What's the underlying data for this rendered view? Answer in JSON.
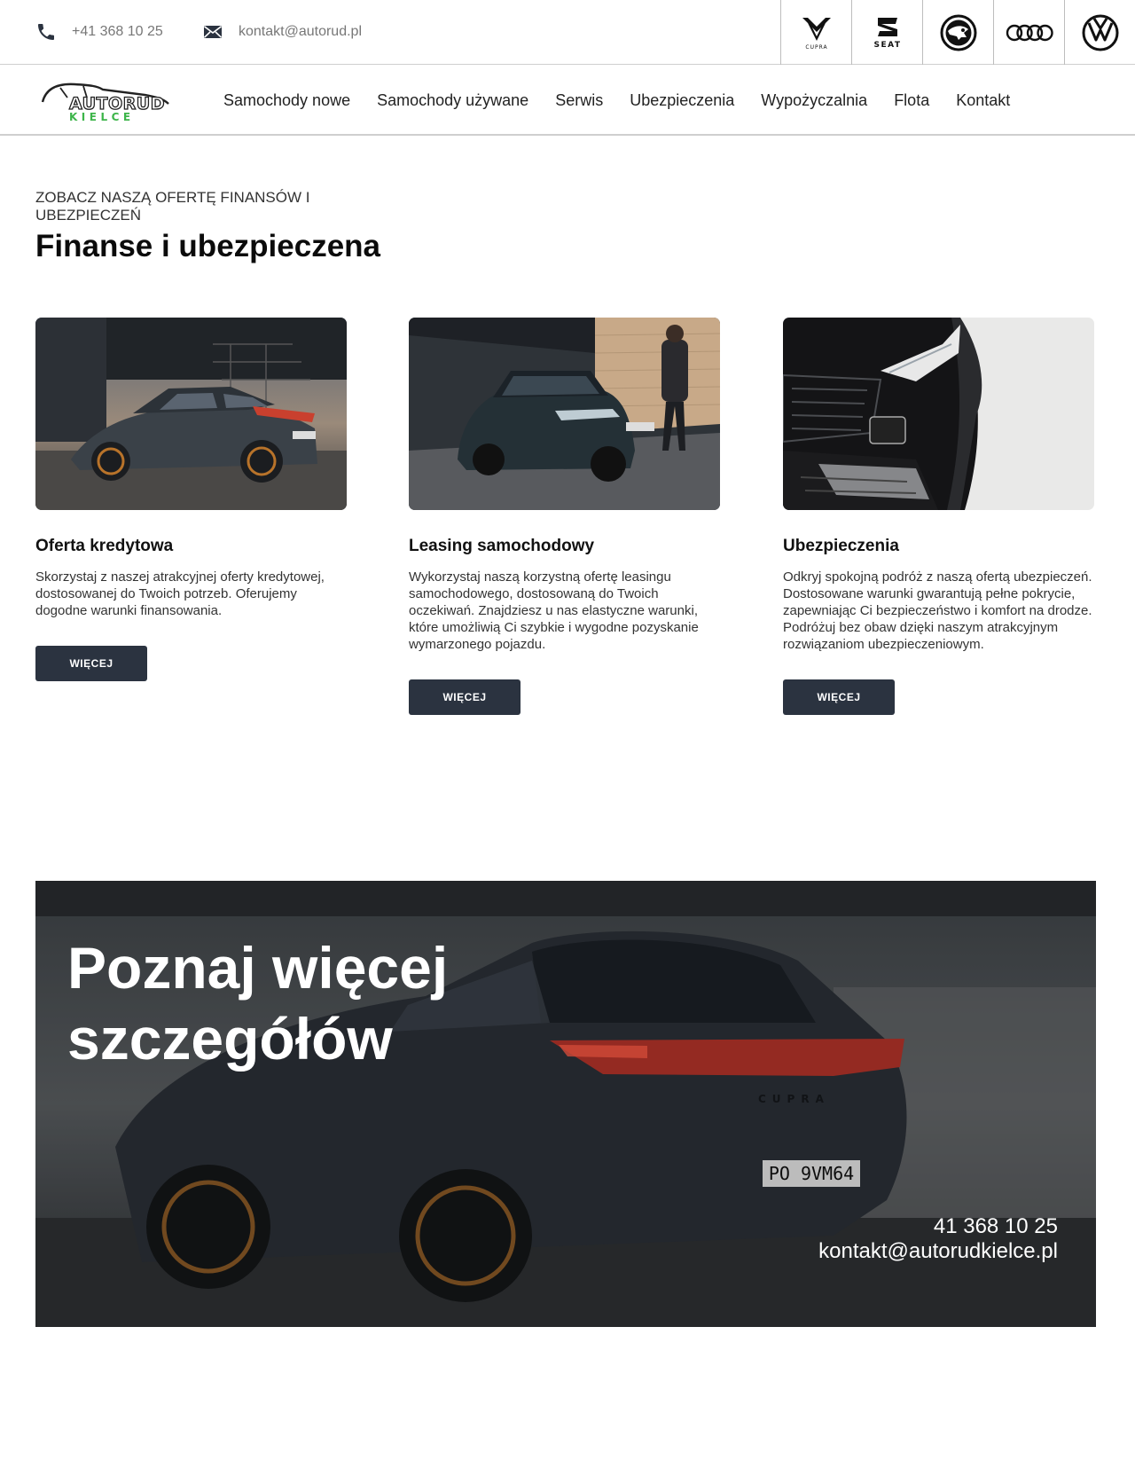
{
  "topbar": {
    "phone": "+41 368 10 25",
    "email": "kontakt@autorud.pl",
    "brands": [
      "cupra",
      "seat",
      "skoda",
      "audi",
      "volkswagen"
    ],
    "brand_labels": {
      "cupra": "CUPRA",
      "seat": "SEAT"
    }
  },
  "logo": {
    "line1": "AUTORUD",
    "line2": "KIELCE",
    "accent": "#3db54a"
  },
  "nav": [
    "Samochody nowe",
    "Samochody używane",
    "Serwis",
    "Ubezpieczenia",
    "Wypożyczalnia",
    "Flota",
    "Kontakt"
  ],
  "section": {
    "eyebrow": "ZOBACZ NASZĄ OFERTĘ FINANSÓW I UBEZPIECZEŃ",
    "title": "Finanse i ubezpieczena"
  },
  "cards": [
    {
      "title": "Oferta kredytowa",
      "text": "Skorzystaj z naszej atrakcyjnej oferty kredytowej, dostosowanej do Twoich potrzeb. Oferujemy dogodne warunki finansowania.",
      "button": "WIĘCEJ"
    },
    {
      "title": "Leasing samochodowy",
      "text": "Wykorzystaj naszą korzystną ofertę leasingu samochodowego, dostosowaną do Twoich oczekiwań. Znajdziesz u nas elastyczne warunki, które umożliwią Ci szybkie i wygodne pozyskanie wymarzonego pojazdu.",
      "button": "WIĘCEJ"
    },
    {
      "title": "Ubezpieczenia",
      "text": "Odkryj spokojną podróż z naszą ofertą ubezpieczeń. Dostosowane warunki gwarantują pełne pokrycie, zapewniając Ci bezpieczeństwo i komfort na drodze. Podróżuj bez obaw dzięki naszym atrakcyjnym rozwiązaniom ubezpieczeniowym.",
      "button": "WIĘCEJ"
    }
  ],
  "hero": {
    "title": "Poznaj więcej szczegółów",
    "phone": "41 368 10 25",
    "email": "kontakt@autorudkielce.pl",
    "plate": "PO 9VM64",
    "badge": "CUPRA"
  },
  "colors": {
    "button_bg": "#2b3340",
    "accent_green": "#3db54a"
  }
}
